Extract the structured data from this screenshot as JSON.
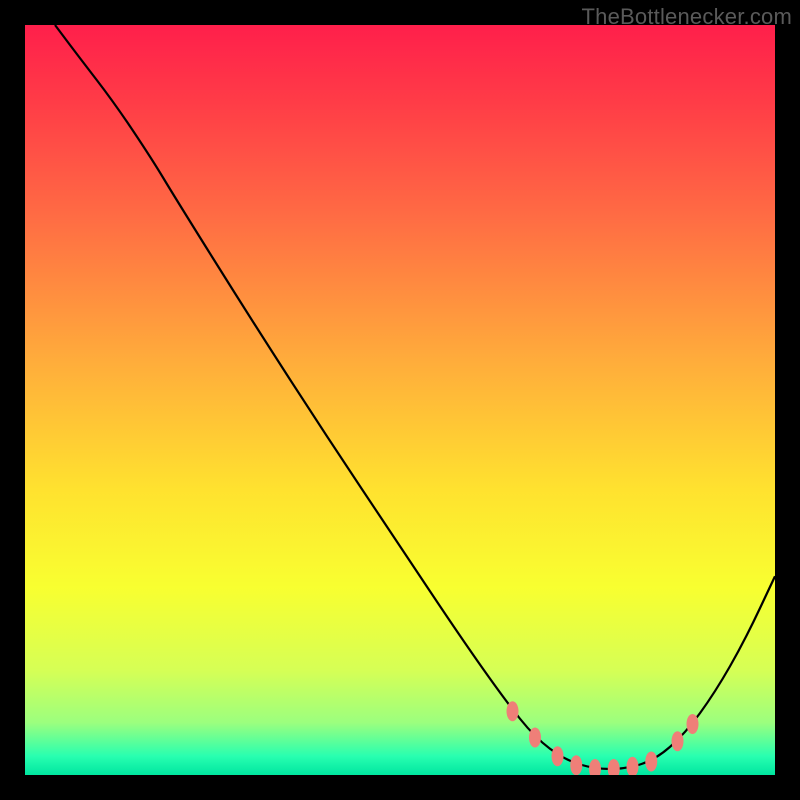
{
  "watermark": "TheBottlenecker.com",
  "chart_data": {
    "type": "line",
    "title": "",
    "xlabel": "",
    "ylabel": "",
    "xlim": [
      0,
      100
    ],
    "ylim": [
      0,
      100
    ],
    "background_gradient": {
      "stops": [
        {
          "pos": 0.0,
          "color": "#ff1f4b"
        },
        {
          "pos": 0.1,
          "color": "#ff3b47"
        },
        {
          "pos": 0.25,
          "color": "#ff6a44"
        },
        {
          "pos": 0.45,
          "color": "#ffad3b"
        },
        {
          "pos": 0.62,
          "color": "#ffe22f"
        },
        {
          "pos": 0.75,
          "color": "#f8ff30"
        },
        {
          "pos": 0.86,
          "color": "#d6ff55"
        },
        {
          "pos": 0.93,
          "color": "#9cff7e"
        },
        {
          "pos": 0.975,
          "color": "#28ffb0"
        },
        {
          "pos": 1.0,
          "color": "#00e6a0"
        }
      ]
    },
    "curve": {
      "stroke": "#000000",
      "stroke_width": 2.2,
      "points": [
        {
          "x": 4.0,
          "y": 100.0
        },
        {
          "x": 7.0,
          "y": 96.0
        },
        {
          "x": 12.0,
          "y": 89.5
        },
        {
          "x": 17.0,
          "y": 82.0
        },
        {
          "x": 20.0,
          "y": 77.0
        },
        {
          "x": 30.0,
          "y": 61.0
        },
        {
          "x": 40.0,
          "y": 45.5
        },
        {
          "x": 50.0,
          "y": 30.5
        },
        {
          "x": 58.0,
          "y": 18.5
        },
        {
          "x": 64.0,
          "y": 10.0
        },
        {
          "x": 68.0,
          "y": 5.0
        },
        {
          "x": 72.0,
          "y": 2.0
        },
        {
          "x": 76.0,
          "y": 0.8
        },
        {
          "x": 80.0,
          "y": 0.8
        },
        {
          "x": 84.0,
          "y": 2.0
        },
        {
          "x": 88.0,
          "y": 5.5
        },
        {
          "x": 92.0,
          "y": 11.0
        },
        {
          "x": 96.0,
          "y": 18.0
        },
        {
          "x": 100.0,
          "y": 26.5
        }
      ]
    },
    "markers": {
      "fill": "#ef7f78",
      "rx": 6,
      "ry": 10,
      "points": [
        {
          "x": 65.0,
          "y": 8.5
        },
        {
          "x": 68.0,
          "y": 5.0
        },
        {
          "x": 71.0,
          "y": 2.5
        },
        {
          "x": 73.5,
          "y": 1.3
        },
        {
          "x": 76.0,
          "y": 0.8
        },
        {
          "x": 78.5,
          "y": 0.8
        },
        {
          "x": 81.0,
          "y": 1.1
        },
        {
          "x": 83.5,
          "y": 1.8
        },
        {
          "x": 87.0,
          "y": 4.5
        },
        {
          "x": 89.0,
          "y": 6.8
        }
      ]
    }
  }
}
